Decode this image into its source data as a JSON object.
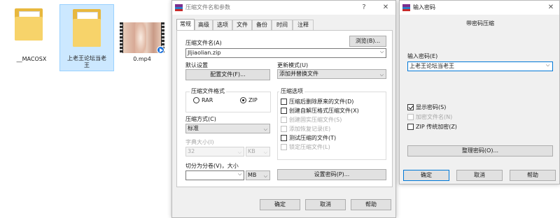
{
  "desktop": {
    "files": [
      {
        "name": "__MACOSX",
        "icon": "folder-icon"
      },
      {
        "name": "上老王论坛当老\n王",
        "icon": "folder-icon"
      },
      {
        "name": "0.mp4",
        "icon": "video-file-icon"
      }
    ]
  },
  "archive_dialog": {
    "title": "压缩文件名和参数",
    "help_glyph": "?",
    "close_glyph": "✕",
    "tabs": [
      "常规",
      "高级",
      "选项",
      "文件",
      "备份",
      "时间",
      "注释"
    ],
    "archive_name_label": "压缩文件名(A)",
    "browse_label": "浏览(B)...",
    "archive_name_value": "JIjiaolian.zip",
    "defaults_label": "默认设置",
    "profiles_label": "配置文件(F)...",
    "update_mode_label": "更新模式(U)",
    "update_mode_value": "添加并替换文件",
    "format_group_label": "压缩文件格式",
    "format_options": [
      "RAR",
      "ZIP"
    ],
    "selected_format": "ZIP",
    "options_group_label": "压缩选项",
    "options": [
      {
        "label": "压缩后删除原来的文件(D)",
        "checked": false,
        "enabled": true
      },
      {
        "label": "创建自解压格式压缩文件(X)",
        "checked": false,
        "enabled": true
      },
      {
        "label": "创建固实压缩文件(S)",
        "checked": false,
        "enabled": false
      },
      {
        "label": "添加恢复记录(E)",
        "checked": false,
        "enabled": false
      },
      {
        "label": "测试压缩的文件(T)",
        "checked": false,
        "enabled": true
      },
      {
        "label": "锁定压缩文件(L)",
        "checked": false,
        "enabled": false
      }
    ],
    "method_label": "压缩方式(C)",
    "method_value": "标准",
    "dict_label": "字典大小(I)",
    "dict_value": "32",
    "dict_unit": "KB",
    "split_label": "切分为分卷(V)，大小",
    "split_value": "",
    "split_unit": "MB",
    "set_password_label": "设置密码(P)...",
    "ok_label": "确定",
    "cancel_label": "取消",
    "help_label": "帮助"
  },
  "password_dialog": {
    "title": "输入密码",
    "close_glyph": "✕",
    "heading": "带密码压缩",
    "password_label": "输入密码(E)",
    "password_value": "上老王论坛当老王",
    "show_password_label": "显示密码(S)",
    "show_password_checked": true,
    "encrypt_names_label": "加密文件名(N)",
    "encrypt_names_enabled": false,
    "zip_legacy_label": "ZIP 传统加密(Z)",
    "zip_legacy_checked": false,
    "organize_label": "整理密码(O)...",
    "ok_label": "确定",
    "cancel_label": "取消",
    "help_label": "帮助"
  }
}
